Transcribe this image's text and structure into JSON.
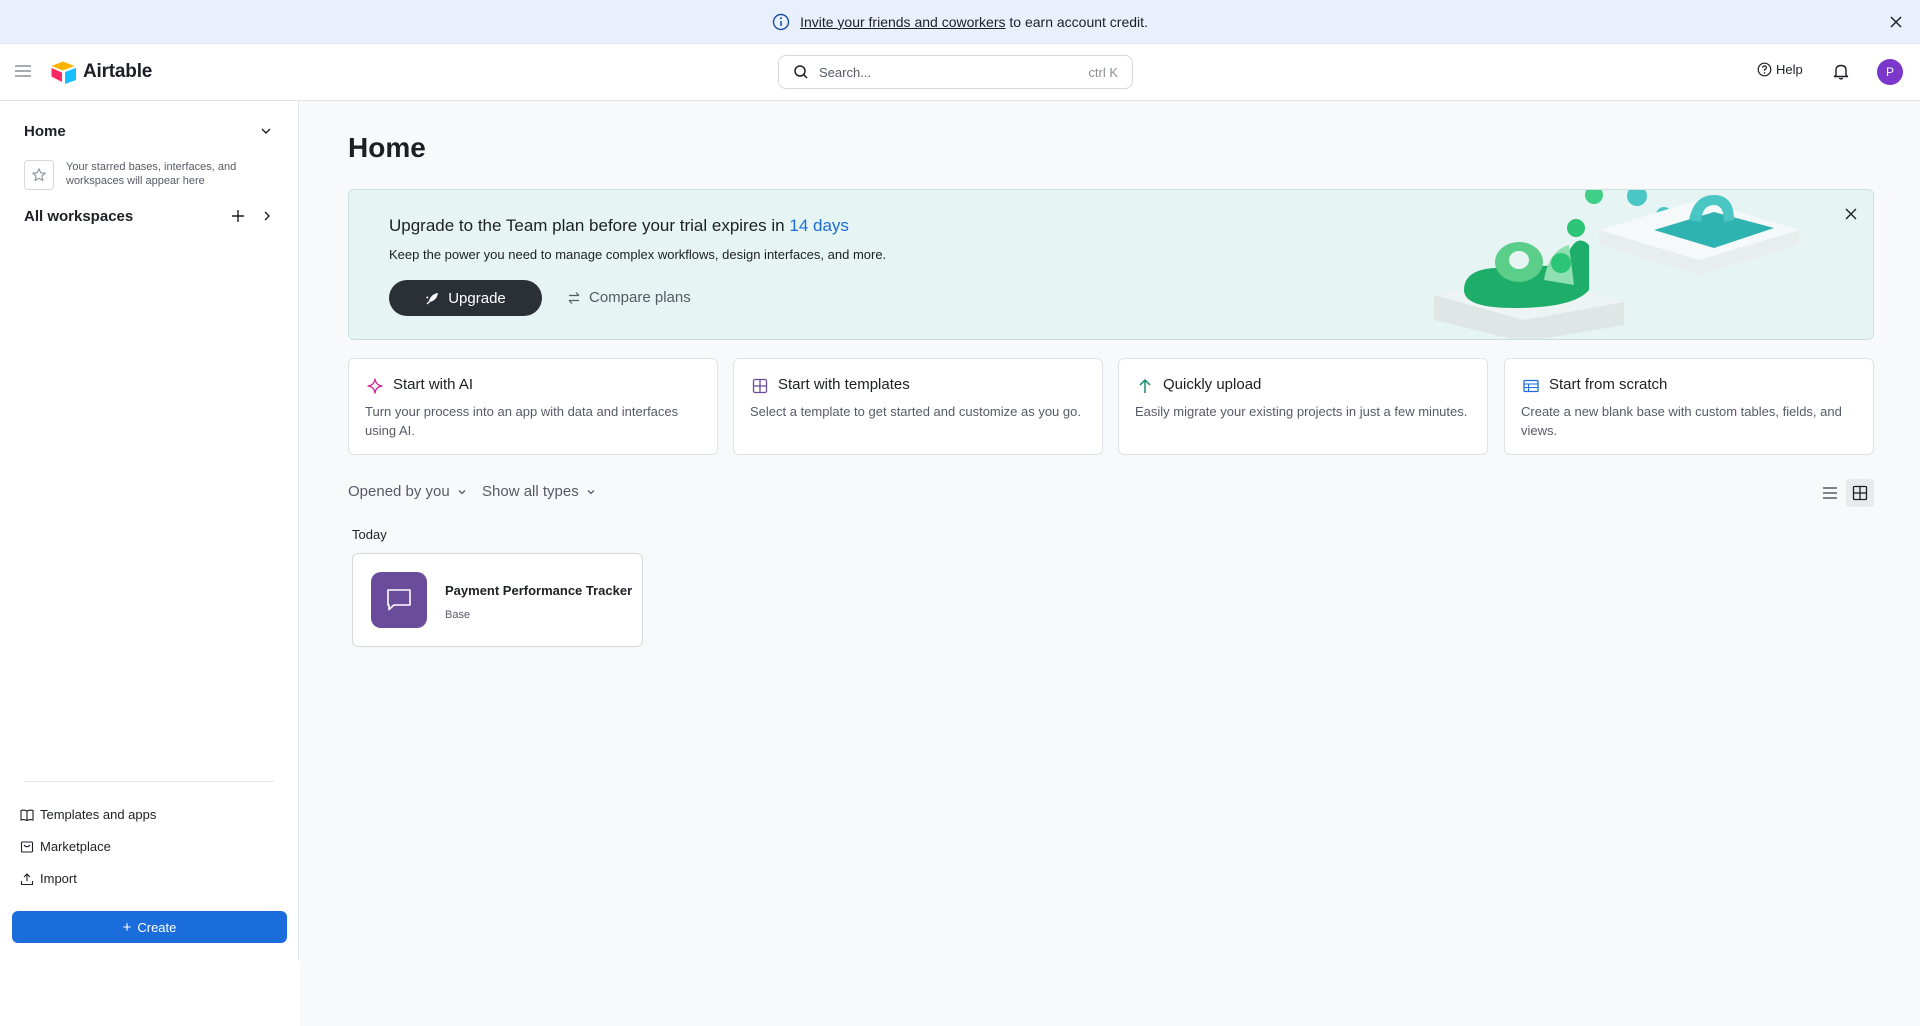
{
  "banner": {
    "link_text": "Invite your friends and coworkers",
    "rest_text": " to earn account credit."
  },
  "header": {
    "app_name": "Airtable",
    "search_placeholder": "Search...",
    "search_shortcut": "ctrl K",
    "help_label": "Help",
    "avatar_initial": "P"
  },
  "sidebar": {
    "home_label": "Home",
    "starred_hint": "Your starred bases, interfaces, and workspaces will appear here",
    "workspaces_label": "All workspaces",
    "links": [
      {
        "label": "Templates and apps",
        "icon": "book-icon"
      },
      {
        "label": "Marketplace",
        "icon": "marketplace-icon"
      },
      {
        "label": "Import",
        "icon": "upload-icon"
      }
    ],
    "create_label": "Create"
  },
  "main": {
    "title": "Home",
    "promo": {
      "title_prefix": "Upgrade to the Team plan before your trial expires in ",
      "days_text": "14 days",
      "subtitle": "Keep the power you need to manage complex workflows, design interfaces, and more.",
      "upgrade_label": "Upgrade",
      "compare_label": "Compare plans"
    },
    "cards": [
      {
        "title": "Start with AI",
        "desc": "Turn your process into an app with data and interfaces using AI.",
        "icon": "sparkle-icon"
      },
      {
        "title": "Start with templates",
        "desc": "Select a template to get started and customize as you go.",
        "icon": "grid-icon"
      },
      {
        "title": "Quickly upload",
        "desc": "Easily migrate your existing projects in just a few minutes.",
        "icon": "arrow-up-icon"
      },
      {
        "title": "Start from scratch",
        "desc": "Create a new blank base with custom tables, fields, and views.",
        "icon": "table-icon"
      }
    ],
    "filters": {
      "opened_by": "Opened by you",
      "types": "Show all types"
    },
    "section_label": "Today",
    "bases": [
      {
        "name": "Payment Performance Tracker",
        "type": "Base",
        "color": "#6b4c9a"
      }
    ]
  },
  "colors": {
    "accent": "#1b6ddb",
    "avatar": "#7a37c9",
    "base_icon": "#6b4c9a",
    "promo_bg": "#e6f4f3"
  }
}
